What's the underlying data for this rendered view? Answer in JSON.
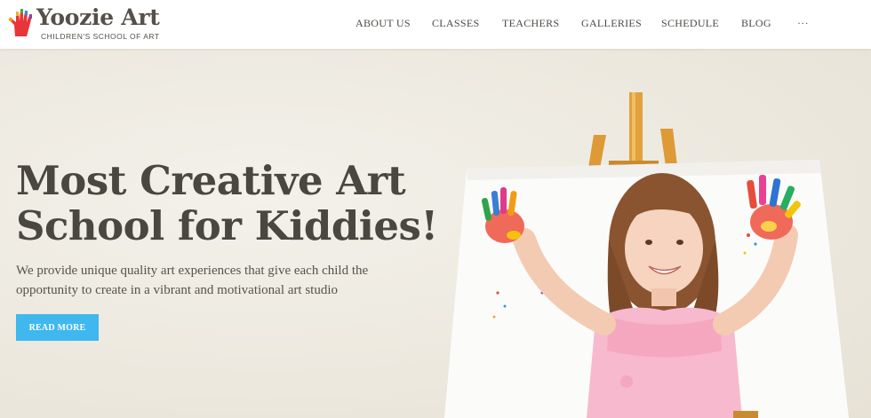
{
  "logo": {
    "title": "Yoozie Art",
    "subtitle": "CHILDREN'S SCHOOL OF ART",
    "icon": "painted-hand-icon"
  },
  "nav": {
    "items": [
      {
        "label": "ABOUT US"
      },
      {
        "label": "CLASSES"
      },
      {
        "label": "TEACHERS"
      },
      {
        "label": "GALLERIES"
      },
      {
        "label": "SCHEDULE"
      },
      {
        "label": "BLOG"
      },
      {
        "label": "···"
      }
    ]
  },
  "hero": {
    "title_line1": "Most Creative Art",
    "title_line2": "School for Kiddies!",
    "text": "We provide unique quality art experiences that give each child the opportunity to create in a vibrant and motivational art studio",
    "button_label": "READ MORE",
    "image": "girl-with-painted-hands-at-easel"
  },
  "colors": {
    "accent": "#3eb8ee",
    "text_dark": "#4a4640",
    "background": "#efece4",
    "header_bg": "#ffffff"
  }
}
